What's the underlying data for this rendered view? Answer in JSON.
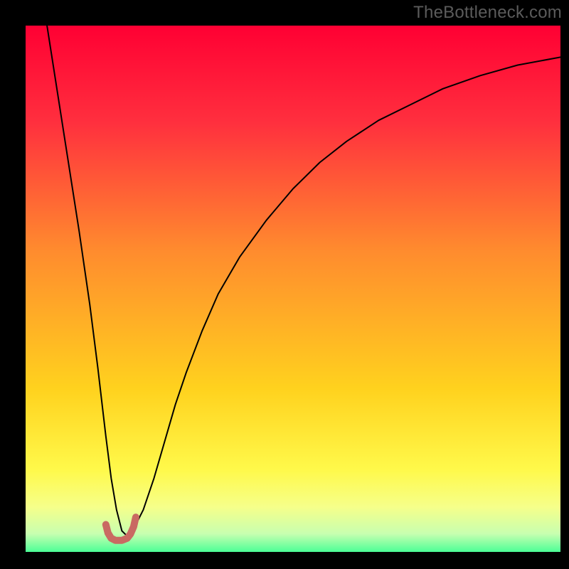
{
  "watermark": "TheBottleneck.com",
  "chart_data": {
    "type": "line",
    "title": "",
    "xlabel": "",
    "ylabel": "",
    "xlim": [
      0,
      100
    ],
    "ylim": [
      0,
      100
    ],
    "grid": false,
    "legend": false,
    "series": [
      {
        "name": "bottleneck-curve",
        "color": "#000000",
        "x": [
          4,
          6,
          8,
          10,
          12,
          13.5,
          15,
          16,
          17,
          18,
          19,
          20,
          22,
          24,
          26,
          28,
          30,
          33,
          36,
          40,
          45,
          50,
          55,
          60,
          66,
          72,
          78,
          85,
          92,
          100
        ],
        "y": [
          100,
          87,
          74,
          61,
          47,
          35,
          22,
          14,
          8,
          4,
          3,
          4,
          8,
          14,
          21,
          28,
          34,
          42,
          49,
          56,
          63,
          69,
          74,
          78,
          82,
          85,
          88,
          90.5,
          92.5,
          94
        ]
      }
    ],
    "marker": {
      "name": "optimal-range-marker",
      "color": "#c96a62",
      "x": [
        15.0,
        15.4,
        16.0,
        16.8,
        18.0,
        19.0,
        19.6,
        20.2,
        20.6
      ],
      "y": [
        5.2,
        3.6,
        2.6,
        2.2,
        2.2,
        2.6,
        3.4,
        4.8,
        6.6
      ]
    },
    "background_gradient": {
      "direction": "vertical",
      "stops": [
        {
          "offset": 0.0,
          "color": "#ff0033"
        },
        {
          "offset": 0.18,
          "color": "#ff2f3e"
        },
        {
          "offset": 0.42,
          "color": "#ff8b2e"
        },
        {
          "offset": 0.68,
          "color": "#ffd21e"
        },
        {
          "offset": 0.83,
          "color": "#fff94a"
        },
        {
          "offset": 0.9,
          "color": "#f6ff8a"
        },
        {
          "offset": 0.95,
          "color": "#c8ffb0"
        },
        {
          "offset": 0.98,
          "color": "#5bff9a"
        },
        {
          "offset": 1.0,
          "color": "#00e27a"
        }
      ]
    }
  }
}
